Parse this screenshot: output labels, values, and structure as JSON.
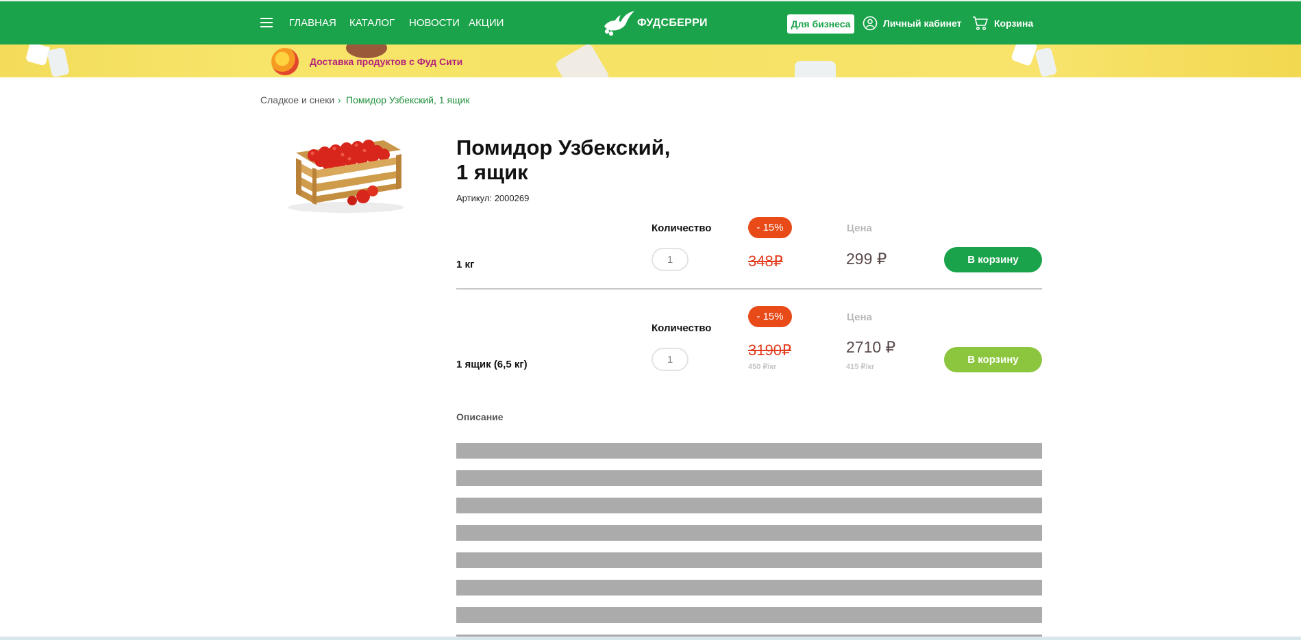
{
  "header": {
    "nav": [
      "ГЛАВНАЯ",
      "КАТАЛОГ",
      "НОВОСТИ",
      "АКЦИИ"
    ],
    "logo_text": "ФУДСБЕРРИ",
    "business_button": "Для бизнеса",
    "account_label": "Личный кабинет",
    "cart_label": "Корзина",
    "brand_color": "#1aa34a"
  },
  "banner": {
    "text": "Доставка продуктов с Фуд Сити"
  },
  "breadcrumb": {
    "items": [
      "Сладкое и снеки",
      "Помидор Узбекский, 1 ящик"
    ],
    "separator": "›"
  },
  "product": {
    "title_line1": "Помидор Узбекский,",
    "title_line2": "1 ящик",
    "sku": "Артикул: 2000269",
    "offers": [
      {
        "unit": "1 кг",
        "qty_label": "Количество",
        "qty_value": "1",
        "discount": "- 15%",
        "price_label": "Цена",
        "old_price": "348₽",
        "new_price": "299 ₽",
        "button": "В корзину",
        "button_color": "#1aa34a"
      },
      {
        "unit": "1 ящик (6,5 кг)",
        "qty_label": "Количество",
        "qty_value": "1",
        "discount": "- 15%",
        "price_label": "Цена",
        "old_price": "3190₽",
        "old_per_kg": "450 ₽/кг",
        "new_price": "2710 ₽",
        "new_per_kg": "415 ₽/кг",
        "button": "В корзину",
        "button_color": "#8cc63f"
      }
    ],
    "description_label": "Описание"
  },
  "colors": {
    "discount": "#e84a18",
    "old_price": "#e23b1d",
    "placeholder_bars": "#ababab"
  }
}
